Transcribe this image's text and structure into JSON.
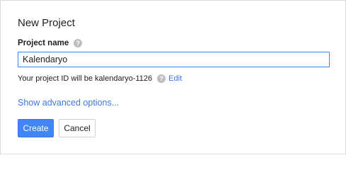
{
  "dialog": {
    "title": "New Project"
  },
  "project_name": {
    "label": "Project name",
    "help_icon": "question-mark-icon",
    "value": "Kalendaryo"
  },
  "project_id": {
    "text": "Your project ID will be kalendaryo-1126",
    "help_icon": "question-mark-icon",
    "edit_label": "Edit"
  },
  "advanced": {
    "label": "Show advanced options..."
  },
  "buttons": {
    "create_label": "Create",
    "cancel_label": "Cancel"
  },
  "colors": {
    "primary": "#4285f4",
    "link": "#3b78e7",
    "help_icon": "#bdbdbd"
  }
}
